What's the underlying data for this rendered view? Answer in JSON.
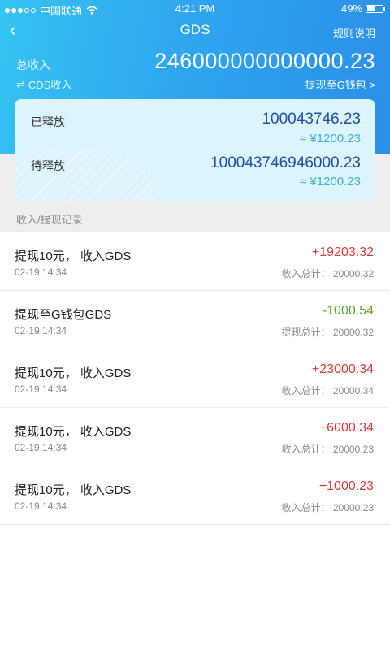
{
  "status_bar": {
    "carrier": "中国联通",
    "time": "4:21 PM",
    "battery": "49%",
    "battery_level": 0.49
  },
  "nav": {
    "back_icon": "‹",
    "title": "GDS",
    "rules_label": "规则说明"
  },
  "summary": {
    "total_label": "总收入",
    "total_value": "246000000000000.23",
    "cds_icon": "⇌",
    "cds_label": "CDS收入",
    "withdraw_link": "提现至G钱包 >"
  },
  "card": {
    "released_label": "已释放",
    "released_value": "100043746.23",
    "released_approx": "≈ ¥1200.23",
    "pending_label": "待释放",
    "pending_value": "100043746946000.23",
    "pending_approx": "≈ ¥1200.23"
  },
  "records": {
    "section_title": "收入/提现记录",
    "items": [
      {
        "title": "提现10元， 收入GDS",
        "date": "02-19  14:34",
        "amount": "+19203.32",
        "sign": "pos",
        "sum": "收入总计： 20000.32"
      },
      {
        "title": "提现至G钱包GDS",
        "date": "02-19  14:34",
        "amount": "-1000.54",
        "sign": "neg",
        "sum": "提现总计： 20000.32"
      },
      {
        "title": "提现10元， 收入GDS",
        "date": "02-19  14:34",
        "amount": "+23000.34",
        "sign": "pos",
        "sum": "收入总计： 20000.34"
      },
      {
        "title": "提现10元， 收入GDS",
        "date": "02-19  14:34",
        "amount": "+6000.34",
        "sign": "pos",
        "sum": "收入总计： 20000.23"
      },
      {
        "title": "提现10元， 收入GDS",
        "date": "02-19  14:34",
        "amount": "+1000.23",
        "sign": "pos",
        "sum": "收入总计： 20000.23"
      }
    ]
  }
}
